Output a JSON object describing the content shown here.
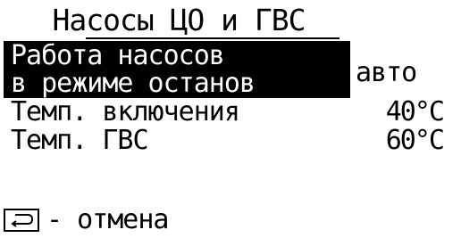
{
  "header": {
    "title": "Насосы ЦО и ГВС"
  },
  "menu": {
    "selected_item": {
      "label_line1": "Работа насосов",
      "label_line2": "в режиме останов",
      "value": "авто"
    },
    "items": [
      {
        "label": "Темп. включения",
        "value": "40°C"
      },
      {
        "label": "Темп. ГВС",
        "value": "60°C"
      }
    ]
  },
  "footer": {
    "icon": "back-arrow-icon",
    "label": "- отмена"
  }
}
